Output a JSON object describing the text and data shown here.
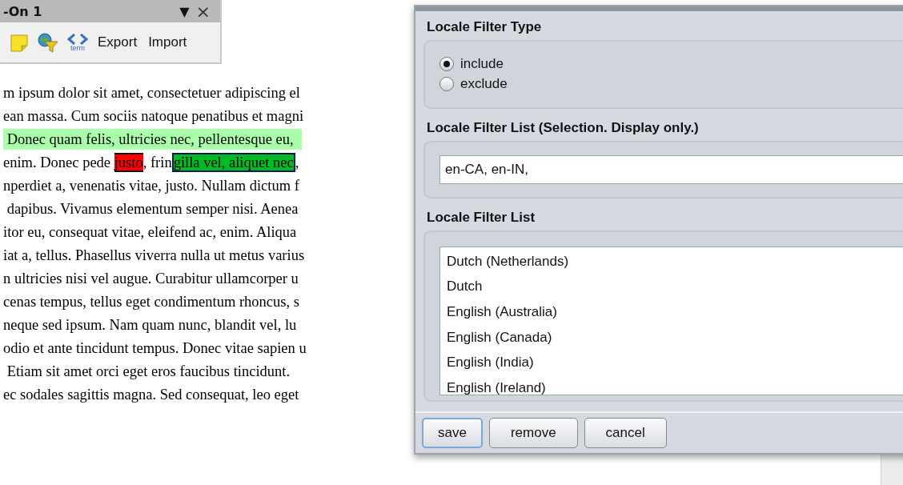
{
  "panel": {
    "title": "-On 1",
    "menu_glyph": "▼",
    "close_glyph": "×",
    "toolbar": [
      {
        "kind": "note"
      },
      {
        "kind": "filter"
      },
      {
        "kind": "term",
        "caption": "term"
      },
      {
        "kind": "text",
        "label": "Export"
      },
      {
        "kind": "text",
        "label": "Import"
      }
    ]
  },
  "document": {
    "lines": [
      [
        {
          "kind": "plain",
          "text": "m ipsum dolor sit amet, consectetuer adipiscing el"
        }
      ],
      [
        {
          "kind": "plain",
          "text": "ean massa. Cum sociis natoque penatibus et magni"
        }
      ],
      [
        {
          "kind": "found",
          "text": " Donec quam felis, ultricies nec, pellentesque eu,"
        }
      ],
      [
        {
          "kind": "plain",
          "text": "enim. Donec pede "
        },
        {
          "kind": "error",
          "text": "justo"
        },
        {
          "kind": "plain",
          "text": ", frin"
        },
        {
          "kind": "match",
          "text": "gilla vel, aliquet nec"
        },
        {
          "kind": "plain",
          "text": ","
        }
      ],
      [
        {
          "kind": "plain",
          "text": "nperdiet a, venenatis vitae, justo. Nullam dictum f"
        }
      ],
      [
        {
          "kind": "plain",
          "text": " dapibus. Vivamus elementum semper nisi. Aenea"
        }
      ],
      [
        {
          "kind": "plain",
          "text": "itor eu, consequat vitae, eleifend ac, enim. Aliqua"
        }
      ],
      [
        {
          "kind": "plain",
          "text": "iat a, tellus. Phasellus viverra nulla ut metus varius"
        }
      ],
      [
        {
          "kind": "plain",
          "text": "n ultricies nisi vel augue. Curabitur ullamcorper u"
        }
      ],
      [
        {
          "kind": "plain",
          "text": "cenas tempus, tellus eget condimentum rhoncus, s"
        }
      ],
      [
        {
          "kind": "plain",
          "text": "neque sed ipsum. Nam quam nunc, blandit vel, lu"
        }
      ],
      [
        {
          "kind": "plain",
          "text": "odio et ante tincidunt tempus. Donec vitae sapien u"
        }
      ],
      [
        {
          "kind": "plain",
          "text": " Etiam sit amet orci eget eros faucibus tincidunt."
        }
      ],
      [
        {
          "kind": "plain",
          "text": "ec sodales sagittis magna. Sed consequat, leo eget"
        }
      ]
    ]
  },
  "dialog": {
    "filter_type": {
      "label": "Locale Filter Type",
      "options": [
        {
          "label": "include",
          "selected": true
        },
        {
          "label": "exclude",
          "selected": false
        }
      ]
    },
    "selection": {
      "label": "Locale Filter List (Selection. Display only.)",
      "value": "en-CA, en-IN,"
    },
    "filter_list": {
      "label": "Locale Filter List",
      "items": [
        "Dutch (Netherlands)",
        "Dutch",
        "English (Australia)",
        "English (Canada)",
        "English (India)",
        "English (Ireland)"
      ]
    },
    "buttons": [
      {
        "label": "save",
        "focused": true
      },
      {
        "label": "remove",
        "focused": false
      },
      {
        "label": "cancel",
        "focused": false
      }
    ]
  }
}
